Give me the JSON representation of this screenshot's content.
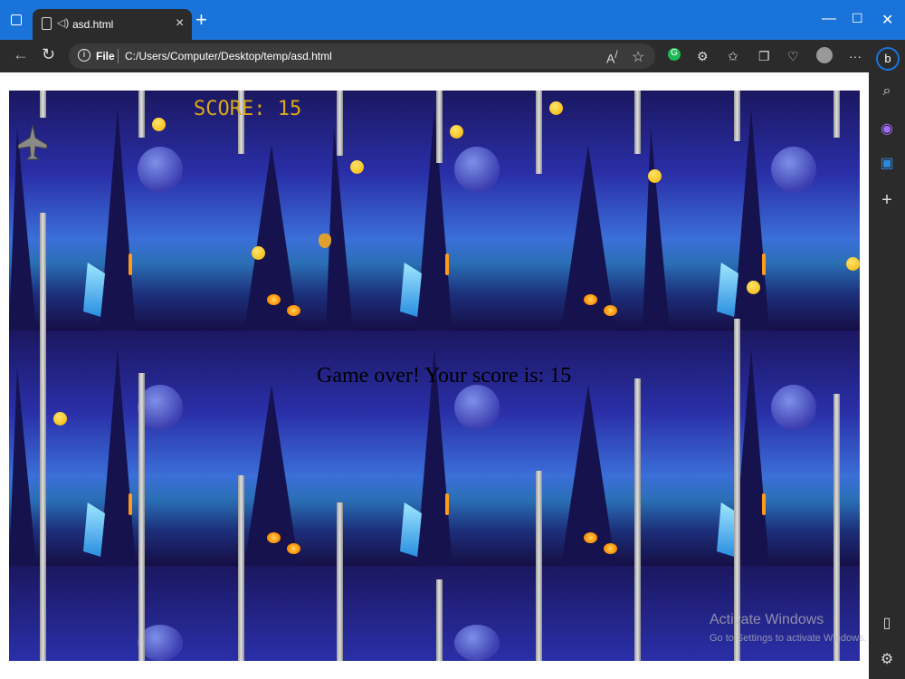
{
  "browser": {
    "tab_title": "asd.html",
    "new_tab_symbol": "+",
    "address_file_label": "File",
    "address_url": "C:/Users/Computer/Desktop/temp/asd.html"
  },
  "game": {
    "score_label": "SCORE: 15",
    "game_over_message": "Game over! Your score is: 15",
    "score": 15
  },
  "watermark": {
    "title": "Activate Windows",
    "subtitle": "Go to Settings to activate Windows."
  },
  "colors": {
    "titlebar": "#1a73d9",
    "score_text": "#d9a91a",
    "coin": "#f3b400"
  },
  "icons": {
    "window": "tab-actions-icon",
    "back": "back-arrow-icon",
    "refresh": "refresh-icon",
    "sidebar": [
      "search-icon",
      "copilot-icon",
      "outlook-icon",
      "add-icon",
      "sidebar-toggle-icon",
      "settings-icon"
    ]
  }
}
